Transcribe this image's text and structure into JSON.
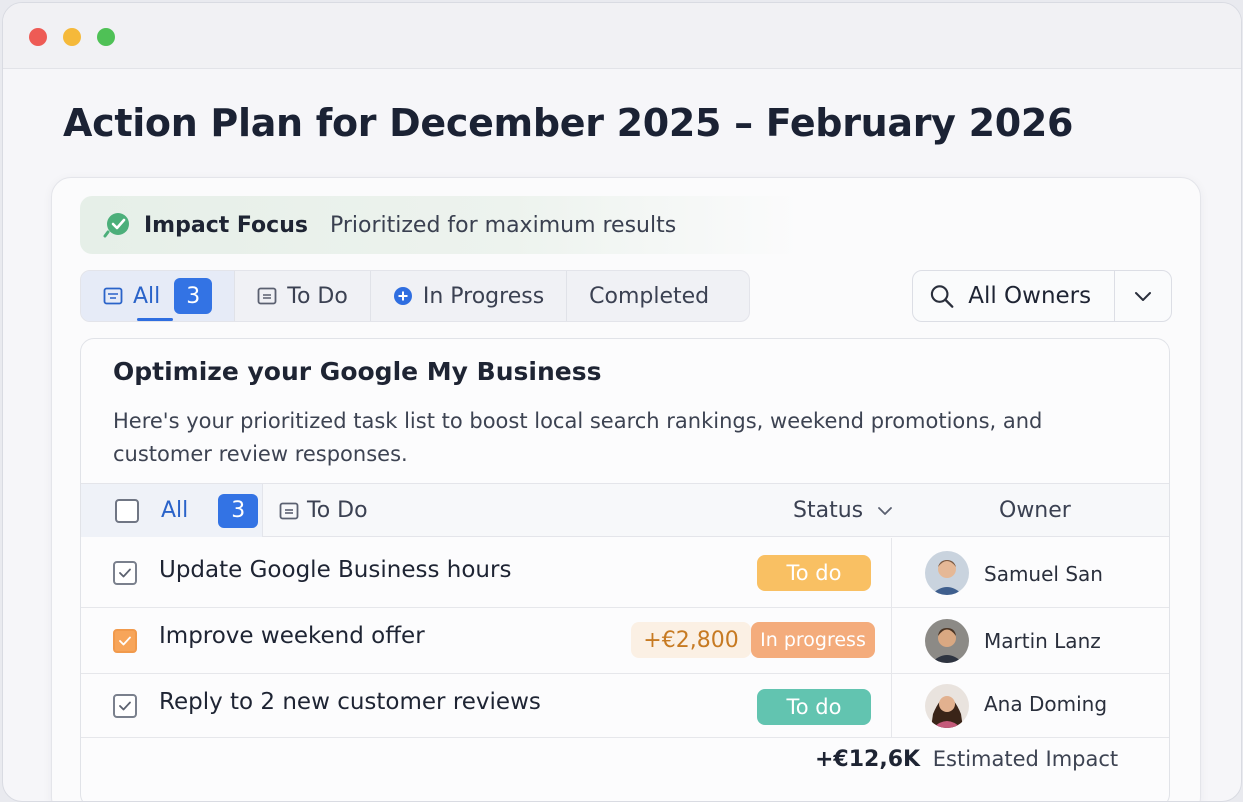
{
  "page": {
    "title": "Action Plan for December 2025 – February 2026"
  },
  "impact": {
    "title": "Impact Focus",
    "subtitle": "Prioritized for maximum results"
  },
  "tabs": [
    {
      "label": "All",
      "count": "3",
      "icon": "list-icon"
    },
    {
      "label": "To Do",
      "icon": "todo-icon"
    },
    {
      "label": "In Progress",
      "icon": "plus-circle-icon"
    },
    {
      "label": "Completed"
    }
  ],
  "owner_filter": {
    "label": "All Owners"
  },
  "card": {
    "title": "Optimize your Google My Business",
    "description": "Here's your prioritized task list to boost local search rankings, weekend promotions, and customer review responses."
  },
  "table": {
    "head": {
      "all_label": "All",
      "all_count": "3",
      "todo_label": "To Do",
      "status_label": "Status",
      "owner_label": "Owner"
    },
    "rows": [
      {
        "task": "Update Google Business hours",
        "status": "To do",
        "owner": "Samuel San"
      },
      {
        "task": "Improve weekend offer",
        "amount": "+€2,800",
        "status": "In progress",
        "owner": "Martin  Lanz"
      },
      {
        "task": "Reply to 2 new customer reviews",
        "status": "To do",
        "owner": "Ana Doming"
      }
    ]
  },
  "summary": {
    "value": "+€12,6K",
    "label": "Estimated Impact"
  },
  "colors": {
    "accent": "#3373e4",
    "todo_yellow": "#f9c063",
    "progress_orange": "#f4ac7c",
    "todo_teal": "#62c4b0"
  }
}
